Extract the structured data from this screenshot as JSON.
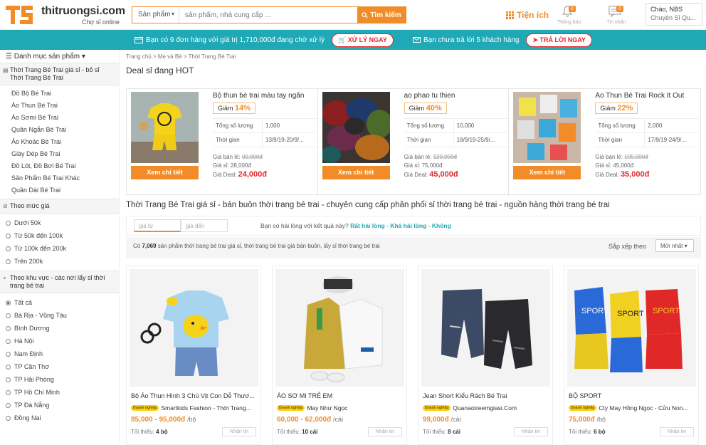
{
  "brand": {
    "name": "thitruongsi.com",
    "tagline": "Chợ sỉ online",
    "colors": {
      "orange": "#f28c28",
      "teal": "#1fa9b7",
      "red": "#e2272e"
    }
  },
  "search": {
    "category": "Sản phẩm",
    "placeholder": "sản phẩm, nhà cung cấp ...",
    "button": "Tìm kiếm"
  },
  "header": {
    "tienich": "Tiện ích",
    "notify": {
      "badge": "0",
      "label": "Thông báo"
    },
    "messages": {
      "badge": "0",
      "label": "Tin nhắn"
    },
    "account": {
      "greeting": "Chào, NBS",
      "subtitle": "Chuyên Sỉ Qu..."
    }
  },
  "notice_bar": {
    "orders_text": "Bạn có 9 đơn hàng với giá trị 1,710,000đ đang chờ xử lý",
    "orders_button": "XỬ LÝ NGAY",
    "reply_text": "Bạn chưa trả lời 5 khách hàng",
    "reply_button": "TRẢ LỜI NGAY"
  },
  "sidebar": {
    "menu_title": "Danh mục sản phẩm",
    "section_title": "Thời Trang Bé Trai giá sỉ - bỏ sỉ Thời Trang Bé Trai",
    "categories": [
      "Đồ Bộ Bé Trai",
      "Áo Thun Bé Trai",
      "Áo Sơmi Bé Trai",
      "Quần Ngắn Bé Trai",
      "Áo Khoác Bé Trai",
      "Giày Dép Bé Trai",
      "Đồ Lót, Đồ Bơi Bé Trai",
      "Sản Phẩm Bé Trai Khác",
      "Quần Dài Bé Trai"
    ],
    "price_title": "Theo mức giá",
    "price_ranges": [
      "Dưới 50k",
      "Từ 50k đến 100k",
      "Từ 100k đến 200k",
      "Trên 200k"
    ],
    "region_title": "Theo khu vực - các nơi lấy sỉ thời trang bé trai",
    "regions": [
      "Tất cả",
      "Bà Rịa - Vũng Tàu",
      "Bình Dương",
      "Hà Nội",
      "Nam Định",
      "TP Cần Thơ",
      "TP Hải Phòng",
      "TP Hồ Chí Minh",
      "TP Đà Nẵng",
      "Đồng Nai"
    ]
  },
  "breadcrumb": "Trang chủ > Mẹ và Bé > Thời Trang Bé Trai",
  "deals": {
    "title": "Deal sỉ đang HOT",
    "items": [
      {
        "name": "Bộ thun bé trai màu tay ngắn",
        "discount_label": "Giảm",
        "discount": "14%",
        "qty_label": "Tổng số lượng",
        "qty": "1,000",
        "time_label": "Thời gian",
        "time": "13/9/19-20/9/...",
        "retail_label": "Giá bán lẻ:",
        "retail": "00,000đ",
        "wholesale_label": "Giá sỉ:",
        "wholesale": "28,000đ",
        "deal_label": "Giá Deal:",
        "deal": "24,000đ",
        "button": "Xem chi tiết"
      },
      {
        "name": "ao phao tu thien",
        "discount_label": "Giảm",
        "discount": "40%",
        "qty_label": "Tổng số lượng",
        "qty": "10,000",
        "time_label": "Thời gian",
        "time": "18/9/19-25/9/...",
        "retail_label": "Giá bán lẻ:",
        "retail": "120,000đ",
        "wholesale_label": "Giá sỉ:",
        "wholesale": "75,000đ",
        "deal_label": "Giá Deal:",
        "deal": "45,000đ",
        "button": "Xem chi tiết"
      },
      {
        "name": "Áo Thun Bé Trai Rock It Out",
        "discount_label": "Giảm",
        "discount": "22%",
        "qty_label": "Tổng số lượng",
        "qty": "2,000",
        "time_label": "Thời gian",
        "time": "17/9/19-24/9/...",
        "retail_label": "Giá bán lẻ:",
        "retail": "105,000đ",
        "wholesale_label": "Giá sỉ:",
        "wholesale": "45,000đ",
        "deal_label": "Giá Deal:",
        "deal": "35,000đ",
        "button": "Xem chi tiết"
      }
    ]
  },
  "category_title": "Thời Trang Bé Trai giá sỉ - bán buôn thời trang bé trai - chuyên cung cấp phân phối sỉ thời trang bé trai - nguồn hàng thời trang bé trai",
  "filter": {
    "price_from": "giá từ",
    "price_to": "giá đến",
    "question": "Bạn có hài lòng với kết quả này?",
    "opt1": "Rất hài lòng",
    "sep": " - ",
    "opt2": "Khá hài lòng",
    "opt3": "Không"
  },
  "results": {
    "prefix": "Có",
    "count": "7,069",
    "suffix": "sản phẩm thời trang bé trai giá sỉ, thời trang bé trai giá bán buôn, lấy sỉ thời trang bé trai",
    "sort_label": "Sắp xếp theo",
    "sort_value": "Mới nhất"
  },
  "products": [
    {
      "name": "Bộ Áo Thun Hình 3 Chú Vịt Con Dễ Thươ...",
      "badge": "Doanh nghiệp",
      "seller": "Smartkids Fashion - Thời Trang...",
      "price": "85,000 - 95,000đ",
      "unit": "/bộ",
      "min_label": "Tối thiểu:",
      "min": "4 bộ",
      "msg": "Nhắn tin"
    },
    {
      "name": "ÁO SƠ MI TRẺ EM",
      "badge": "Doanh nghiệp",
      "seller": "May Như Ngọc",
      "price": "60,000 - 62,000đ",
      "unit": "/cái",
      "min_label": "Tối thiểu:",
      "min": "10 cái",
      "msg": "Nhắn tin"
    },
    {
      "name": "Jean Short Kiểu Rách Bé Trai",
      "badge": "Doanh nghiệp",
      "seller": "Quanaotreemgiasi.Com",
      "price": "99,000đ",
      "unit": "/cái",
      "min_label": "Tối thiểu:",
      "min": "8 cái",
      "msg": "Nhắn tin"
    },
    {
      "name": "BỘ SPORT",
      "badge": "Doanh nghiệp",
      "seller": "Cty May Hồng Ngọc - Cửu Non...",
      "price": "75,000đ",
      "unit": "/bộ",
      "min_label": "Tối thiểu:",
      "min": "6 bộ",
      "msg": "Nhắn tin"
    }
  ]
}
